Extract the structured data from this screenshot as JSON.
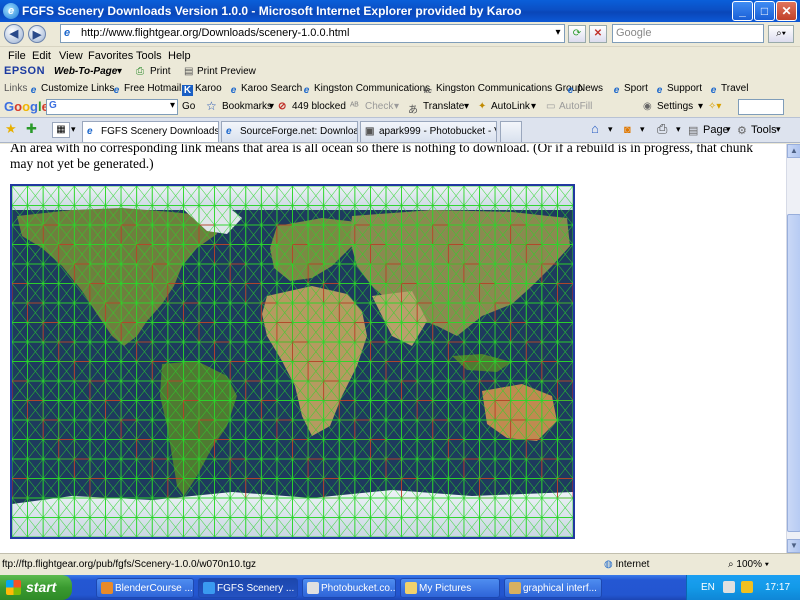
{
  "window": {
    "title": "FGFS Scenery Downloads Version 1.0.0 - Microsoft Internet Explorer provided by Karoo",
    "minimize": "_",
    "maximize": "□",
    "close": "✕"
  },
  "address": {
    "url": "http://www.flightgear.org/Downloads/scenery-1.0.0.html",
    "search_placeholder": "Google"
  },
  "menu": [
    "File",
    "Edit",
    "View",
    "Favorites",
    "Tools",
    "Help"
  ],
  "epson": {
    "logo": "EPSON",
    "web_to_page": "Web-To-Page",
    "print": "Print",
    "print_preview": "Print Preview"
  },
  "links": {
    "label": "Links",
    "items": [
      "Customize Links",
      "Free Hotmail",
      "Karoo",
      "Karoo Search",
      "Kingston Communications",
      "Kingston Communications Group",
      "News",
      "Sport",
      "Support",
      "Travel"
    ]
  },
  "google_bar": {
    "logo": "Google",
    "input_value": "G",
    "go": "Go",
    "bookmarks": "Bookmarks",
    "blocked": "449 blocked",
    "check": "Check",
    "translate": "Translate",
    "autolink": "AutoLink",
    "autofill": "AutoFill",
    "settings": "Settings"
  },
  "tabs": [
    {
      "label": "FGFS Scenery Downloads ..."
    },
    {
      "label": "SourceForge.net: Downloadi..."
    },
    {
      "label": "apark999 - Photobucket - Vid..."
    }
  ],
  "command_bar": {
    "page": "Page",
    "tools": "Tools"
  },
  "content": {
    "paragraph": "An area with no corresponding link means that area is all ocean so there is nothing to download. (Or if a rebuild is in progress, that chunk may not yet be generated.)"
  },
  "status": {
    "text": "ftp://ftp.flightgear.org/pub/fgfs/Scenery-1.0.0/w070n10.tgz",
    "zone": "Internet",
    "zoom": "100%"
  },
  "taskbar": {
    "start": "start",
    "tasks": [
      "BlenderCourse ...",
      "FGFS Scenery ...",
      "Photobucket.co...",
      "My Pictures",
      "graphical interf..."
    ],
    "language": "EN",
    "clock": "17:17"
  },
  "colors": {
    "grid_line": "#2bd62b",
    "ocean_cell_line": "#d02a2a",
    "map_border": "#2238a0"
  }
}
